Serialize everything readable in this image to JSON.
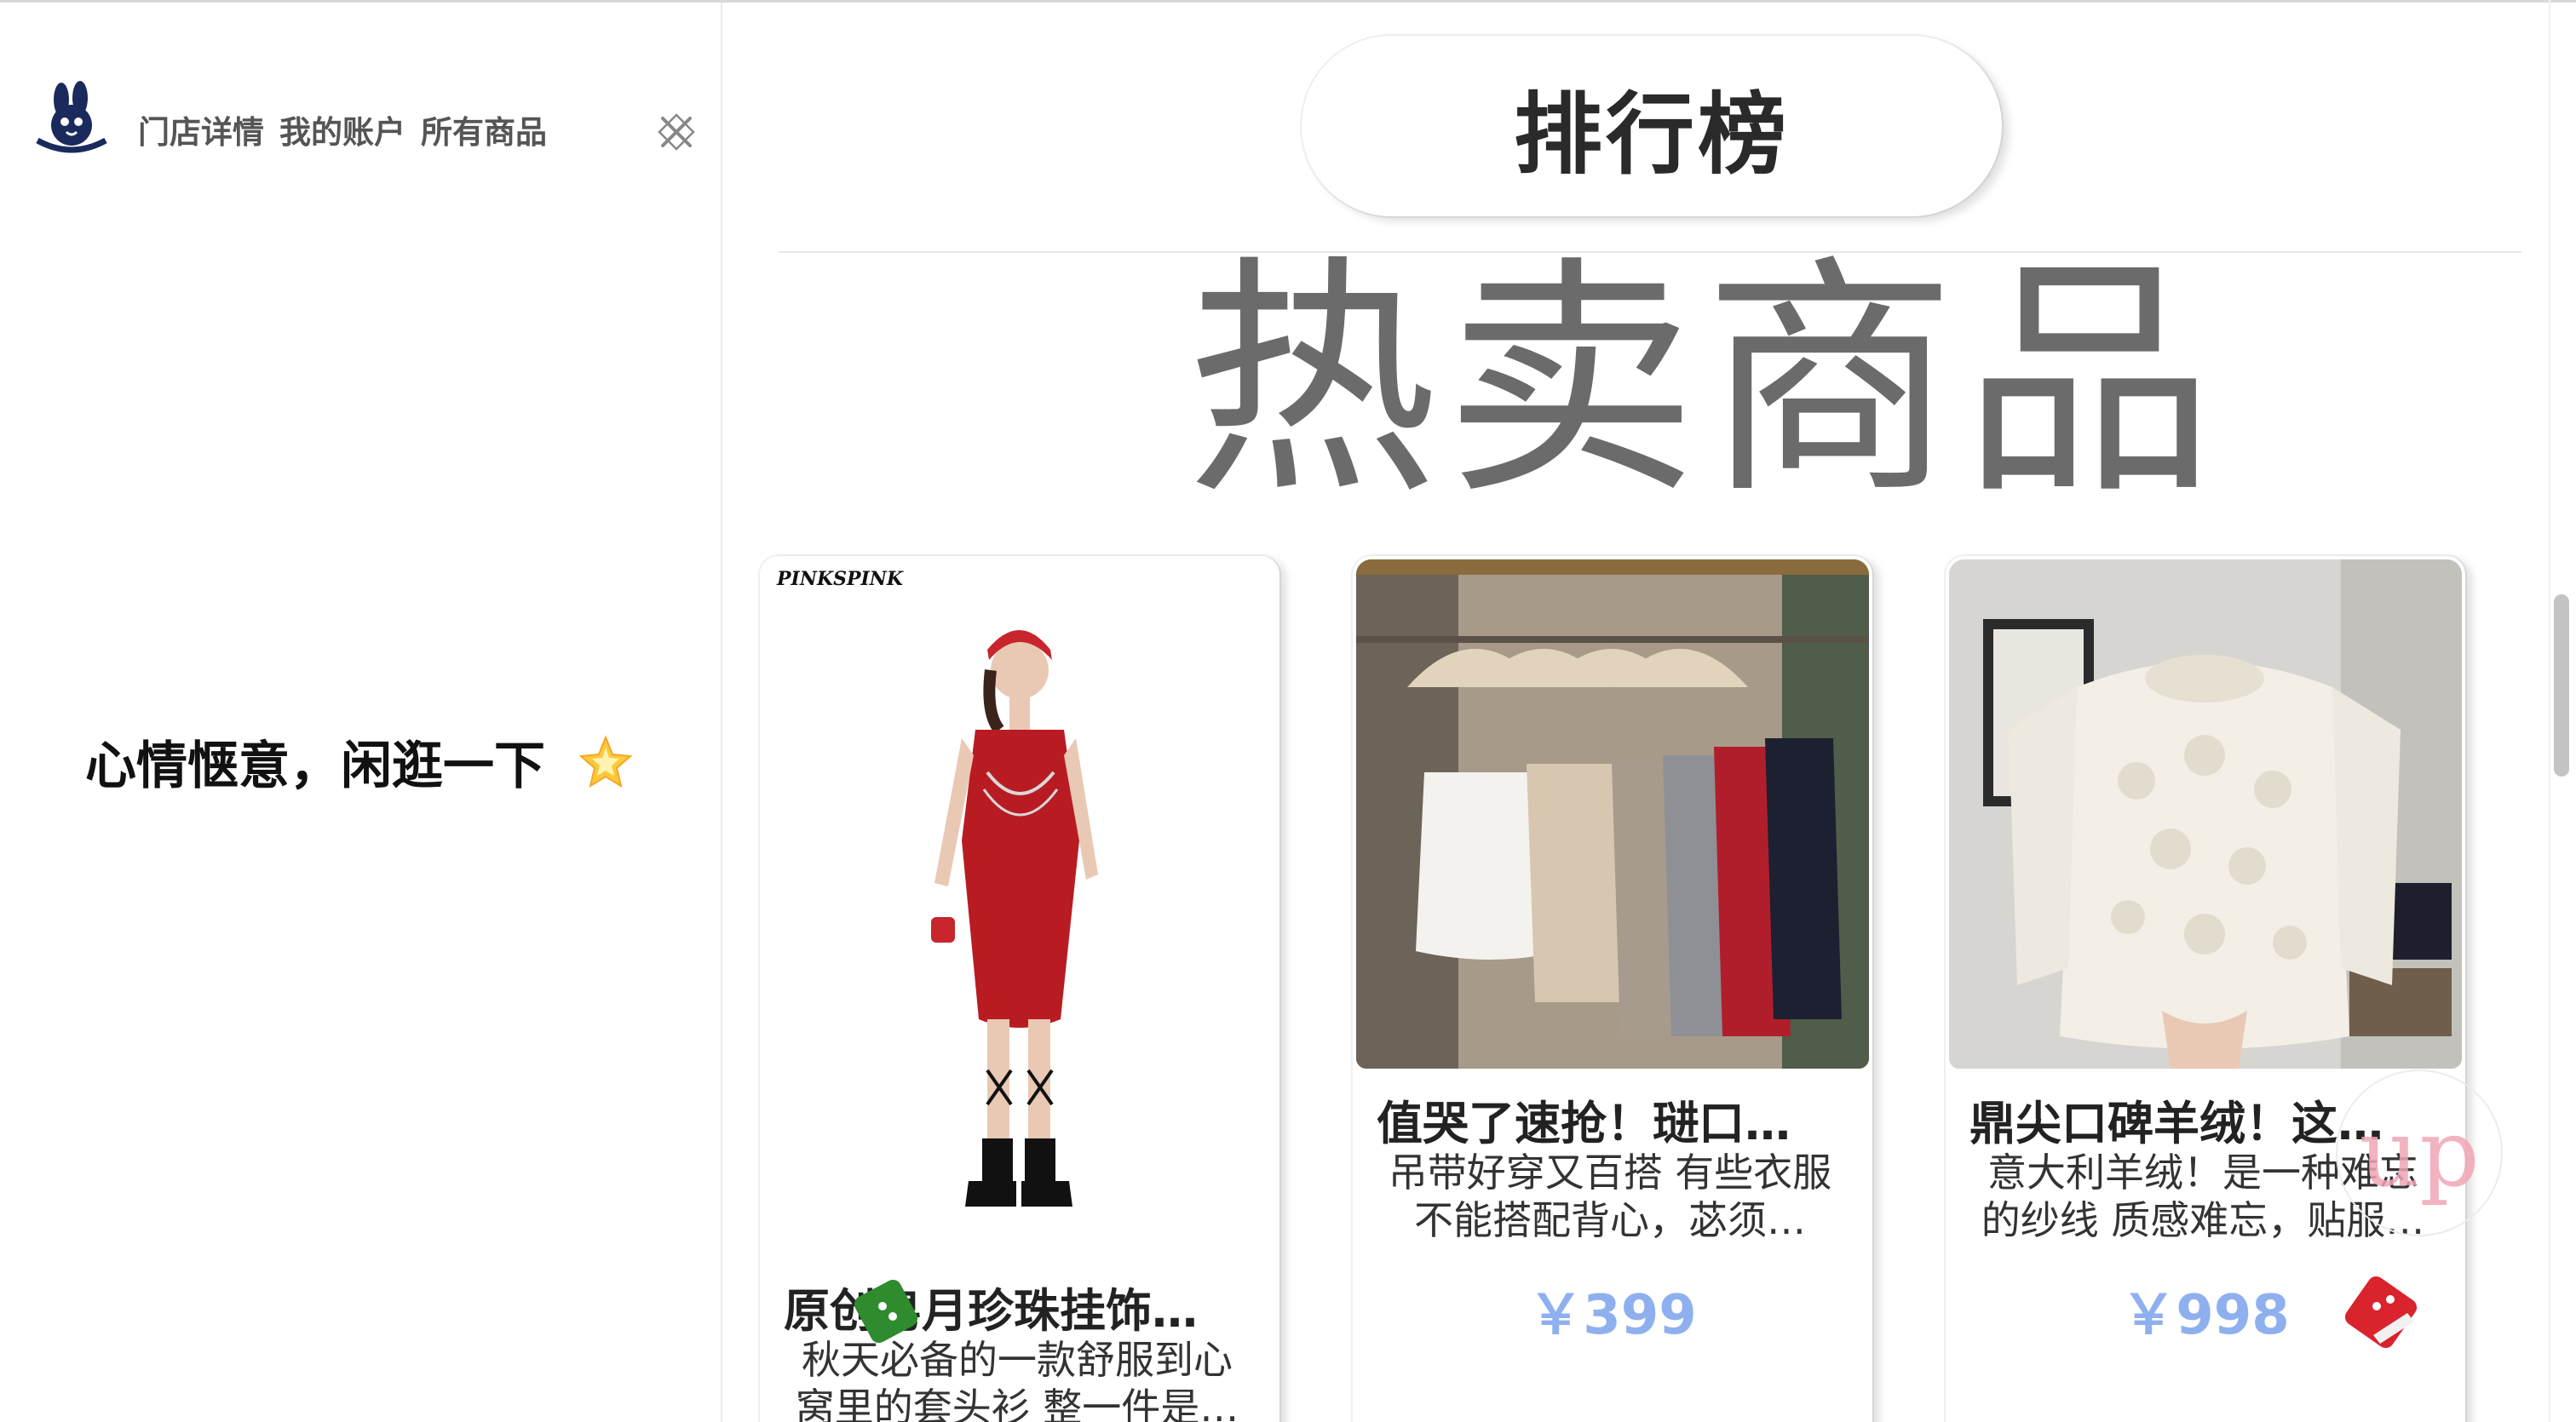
{
  "nav": {
    "items": [
      {
        "label": "门店详情"
      },
      {
        "label": "我的账户"
      },
      {
        "label": "所有商品"
      }
    ]
  },
  "sidebar": {
    "tagline": "心情惬意，闲逛一下"
  },
  "ranking": {
    "label": "排行榜"
  },
  "hot": {
    "title": "热卖商品"
  },
  "products": [
    {
      "title": "原创皂月珍珠挂饰…",
      "desc": "秋天必备的一款舒服到心窝里的套头衫 整一件是…",
      "price": "",
      "image_brand": "PINKSPINK"
    },
    {
      "title": "值哭了速抢！琎口…",
      "desc": "吊带好穿又百搭 有些衣服不能搭配背心，苾须…",
      "price": "￥399"
    },
    {
      "title": "鼎尖口碑羊绒！这…",
      "desc": "意大利羊绒！是一种难忘的纱线 质感难忘，贴服…",
      "price": "￥998"
    }
  ],
  "up_button": {
    "label": "up"
  },
  "colors": {
    "price": "#8fb0ef",
    "hot_title": "#6b6b6b",
    "dress_red": "#b81c22",
    "sticker_green": "#2e8b2e",
    "sticker_red": "#d9232d"
  },
  "icons": {
    "logo": "rabbit-logo",
    "close": "close-icon",
    "star": "star-icon"
  }
}
